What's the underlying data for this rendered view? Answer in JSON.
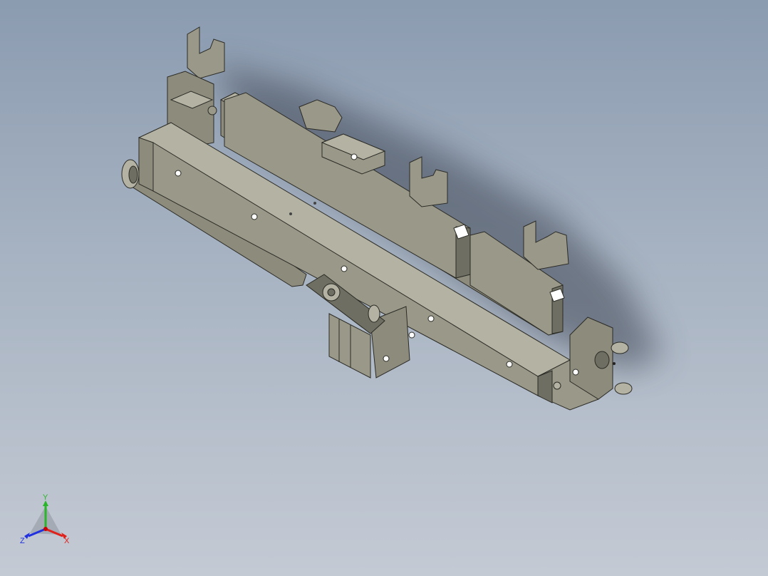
{
  "view": {
    "background_top": "#8b9bb0",
    "background_bottom": "#c4cad4",
    "model_color": "#9a9888",
    "model_dark": "#6f6e62",
    "model_light": "#b4b2a2"
  },
  "triad": {
    "x_label": "X",
    "y_label": "Y",
    "z_label": "Z",
    "x_color": "#e0201a",
    "y_color": "#2bb52b",
    "z_color": "#2030e0"
  }
}
